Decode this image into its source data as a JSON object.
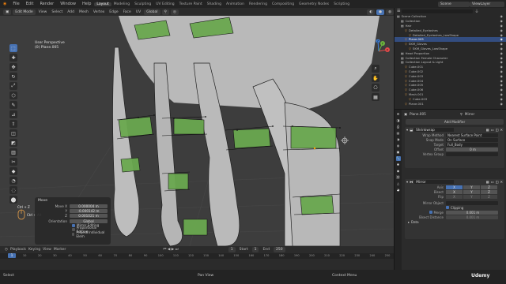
{
  "menubar": {
    "items": [
      "File",
      "Edit",
      "Render",
      "Window",
      "Help"
    ],
    "workspaces": [
      "Layout",
      "Modeling",
      "Sculpting",
      "UV Editing",
      "Texture Paint",
      "Shading",
      "Animation",
      "Rendering",
      "Compositing",
      "Geometry Nodes",
      "Scripting"
    ],
    "active_workspace": "Layout",
    "scene_label": "Scene",
    "viewlayer_label": "ViewLayer"
  },
  "header3d": {
    "mode": "Edit Mode",
    "menus": [
      "View",
      "Select",
      "Add",
      "Mesh",
      "Vertex",
      "Edge",
      "Face",
      "UV"
    ],
    "orientation": "Global",
    "options_label": "Options"
  },
  "viewport": {
    "perspective_label": "User Perspective",
    "object_label": "(0) Plane.005",
    "gizmo_axes": [
      "X",
      "Y",
      "Z"
    ]
  },
  "operator_panel": {
    "title": "Move",
    "rows": [
      {
        "label": "Move X",
        "value": "0.000004 m"
      },
      {
        "label": "Y",
        "value": "-0.000142 m"
      },
      {
        "label": "Z",
        "value": "0.001021 m"
      }
    ],
    "orientation_label": "Orientation",
    "orientation_value": "Global",
    "checks": [
      {
        "label": "Mirror Editing",
        "on": true
      },
      {
        "label": "Proportional Editing",
        "on": false
      },
      {
        "label": "Project Individual Elem",
        "on": false
      }
    ]
  },
  "mouse_hint": {
    "label1": "Ctrl + Z",
    "label2": "Ctrl + Alt"
  },
  "timeline": {
    "menus": [
      "Playback",
      "Keying",
      "View",
      "Marker"
    ],
    "current_frame": "1",
    "start_label": "Start",
    "start": "1",
    "end_label": "End",
    "end": "250",
    "ticks": [
      "0",
      "10",
      "20",
      "30",
      "40",
      "50",
      "60",
      "70",
      "80",
      "90",
      "100",
      "110",
      "120",
      "130",
      "140",
      "150",
      "160",
      "170",
      "180",
      "190",
      "200",
      "210",
      "220",
      "230",
      "240",
      "250"
    ]
  },
  "statusbar": {
    "left": "Select",
    "middle": "Pan View",
    "right": "Context Menu",
    "version": "Udemy"
  },
  "outliner": {
    "search_placeholder": "",
    "rows": [
      {
        "indent": 0,
        "label": "Scene Collection",
        "type": "coll"
      },
      {
        "indent": 1,
        "label": "Collection",
        "type": "coll"
      },
      {
        "indent": 1,
        "label": "Hair",
        "type": "coll"
      },
      {
        "indent": 2,
        "label": "Detailed_Eyelashes",
        "type": "obj"
      },
      {
        "indent": 3,
        "label": "Detailed_Eyelashes_LowShape",
        "type": "obj"
      },
      {
        "indent": 2,
        "label": "Plane.005",
        "type": "obj",
        "selected": true
      },
      {
        "indent": 2,
        "label": "SKM_Gloves",
        "type": "obj"
      },
      {
        "indent": 3,
        "label": "SKM_Gloves_LowShape",
        "type": "obj"
      },
      {
        "indent": 1,
        "label": "Head Proportion",
        "type": "coll"
      },
      {
        "indent": 1,
        "label": "Collection Female Character",
        "type": "coll"
      },
      {
        "indent": 1,
        "label": "Collection Layout & Light",
        "type": "coll"
      },
      {
        "indent": 2,
        "label": "Cube.001",
        "type": "obj"
      },
      {
        "indent": 2,
        "label": "Cube.002",
        "type": "obj"
      },
      {
        "indent": 2,
        "label": "Cube.003",
        "type": "obj"
      },
      {
        "indent": 2,
        "label": "Cube.004",
        "type": "obj"
      },
      {
        "indent": 2,
        "label": "Cube.005",
        "type": "obj"
      },
      {
        "indent": 2,
        "label": "Cube.006",
        "type": "obj"
      },
      {
        "indent": 2,
        "label": "Mesh.001",
        "type": "obj"
      },
      {
        "indent": 3,
        "label": "Cube.003",
        "type": "obj"
      },
      {
        "indent": 2,
        "label": "Plane.001",
        "type": "obj"
      }
    ]
  },
  "properties": {
    "object_name": "Plane.005",
    "modifier_tab": "Mirror",
    "add_modifier": "Add Modifier",
    "shrinkwrap": {
      "name": "Shrinkwrap",
      "rows": [
        {
          "label": "Wrap Method",
          "value": "Nearest Surface Point"
        },
        {
          "label": "Snap Mode",
          "value": "On Surface"
        },
        {
          "label": "Target",
          "value": "Full_Body"
        },
        {
          "label": "Offset",
          "value": "0 m"
        },
        {
          "label": "Vertex Group",
          "value": ""
        }
      ]
    },
    "mirror": {
      "name": "Mirror",
      "axis_label": "Axis",
      "bisect_label": "Bisect",
      "flip_label": "Flip",
      "axes": [
        "X",
        "Y",
        "Z"
      ],
      "mirror_object_label": "Mirror Object",
      "clipping_label": "Clipping",
      "merge_label": "Merge",
      "merge_value": "0.001 m",
      "bisect_distance_label": "Bisect Distance",
      "bisect_distance_value": "0.001 m",
      "data_label": "Data"
    }
  }
}
